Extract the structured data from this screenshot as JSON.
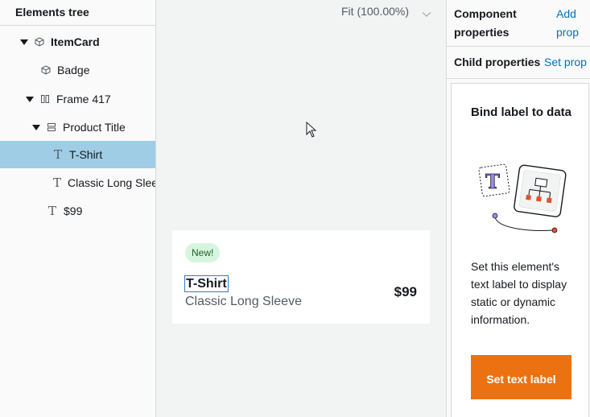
{
  "elements_tree": {
    "header": "Elements tree",
    "items": [
      {
        "label": "ItemCard",
        "icon": "component-cube-icon"
      },
      {
        "label": "Badge",
        "icon": "component-cube-icon"
      },
      {
        "label": "Frame 417",
        "icon": "frame-columns-icon"
      },
      {
        "label": "Product Title",
        "icon": "frame-rows-icon"
      },
      {
        "label": "T-Shirt",
        "icon": "text-icon"
      },
      {
        "label": "Classic Long Sleeve",
        "icon": "text-icon"
      },
      {
        "label": "$99",
        "icon": "text-icon"
      }
    ]
  },
  "canvas": {
    "zoom_label": "Fit (100.00%)",
    "card": {
      "badge": "New!",
      "title": "T-Shirt",
      "subtitle": "Classic Long Sleeve",
      "price": "$99"
    }
  },
  "right_panel": {
    "component_properties": {
      "title": "Component properties",
      "link": "Add prop"
    },
    "child_properties": {
      "title": "Child properties",
      "link": "Set prop"
    },
    "bind": {
      "title": "Bind label to data",
      "description": "Set this element's text label to display static or dynamic information.",
      "button": "Set text label"
    }
  },
  "colors": {
    "selected_row": "#9fcde5",
    "link": "#0073bb",
    "primary_button": "#ec7211",
    "badge_bg": "#d7f5de",
    "canvas_bg": "#f2f3f3"
  }
}
